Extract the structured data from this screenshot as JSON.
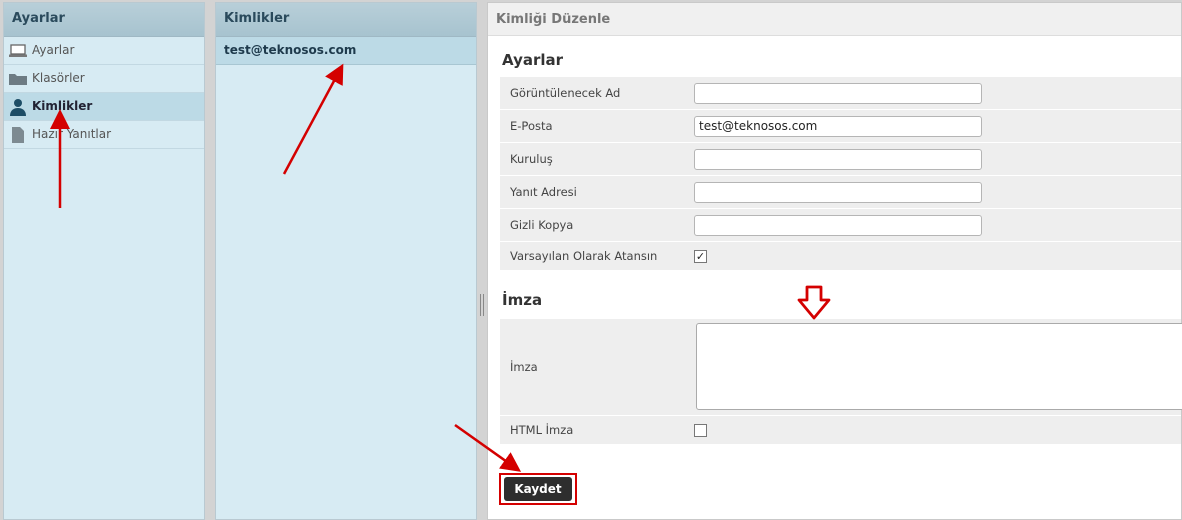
{
  "left": {
    "title": "Ayarlar",
    "items": [
      {
        "label": "Ayarlar",
        "icon": "laptop-icon"
      },
      {
        "label": "Klasörler",
        "icon": "folder-icon"
      },
      {
        "label": "Kimlikler",
        "icon": "user-icon",
        "selected": true
      },
      {
        "label": "Hazır Yanıtlar",
        "icon": "document-icon"
      }
    ]
  },
  "middle": {
    "title": "Kimlikler",
    "items": [
      {
        "label": "test@teknosos.com",
        "selected": true
      }
    ]
  },
  "editor": {
    "title": "Kimliği Düzenle",
    "settings_title": "Ayarlar",
    "fields": {
      "display_name": {
        "label": "Görüntülenecek Ad",
        "value": ""
      },
      "email": {
        "label": "E-Posta",
        "value": "test@teknosos.com"
      },
      "organization": {
        "label": "Kuruluş",
        "value": ""
      },
      "reply_to": {
        "label": "Yanıt Adresi",
        "value": ""
      },
      "bcc": {
        "label": "Gizli Kopya",
        "value": ""
      },
      "default": {
        "label": "Varsayılan Olarak Atansın",
        "checked": true
      }
    },
    "signature_title": "İmza",
    "signature": {
      "label": "İmza",
      "value": ""
    },
    "html_signature": {
      "label": "HTML İmza",
      "checked": false
    },
    "save_label": "Kaydet"
  },
  "annotation_color": "#d40000"
}
